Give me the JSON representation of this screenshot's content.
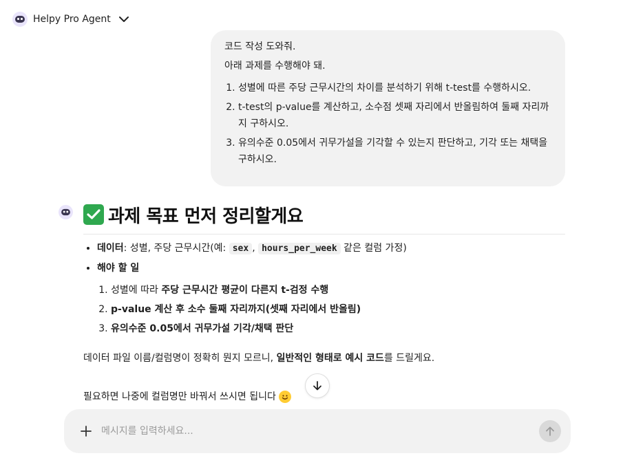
{
  "header": {
    "app_name": "Helpy Pro Agent"
  },
  "user_message": {
    "line1": "코드 작성 도와줘.",
    "line2": "아래 과제를 수행해야 돼.",
    "tasks": [
      "성별에 따른 주당 근무시간의 차이를 분석하기 위해 t-test를 수행하시오.",
      "t-test의 p-value를 계산하고, 소수점 셋째 자리에서 반올림하여 둘째 자리까지 구하시오.",
      "유의수준 0.05에서 귀무가설을 기각할 수 있는지 판단하고, 기각 또는 채택을 구하시오."
    ]
  },
  "answer": {
    "heading": "과제 목표 먼저 정리할게요",
    "bullet1_label": "데이터",
    "bullet1_text": ": 성별, 주당 근무시간(예: ",
    "code_sex": "sex",
    "comma": ",",
    "code_hours": "hours_per_week",
    "bullet1_tail": " 같은 컬럼 가정)",
    "bullet2_label": "해야 할 일",
    "step1_prefix": "성별에 따라 ",
    "step1_bold": "주당 근무시간 평균이 다른지 t-검정 수행",
    "step2_bold": "p-value 계산 후 소수 둘째 자리까지(셋째 자리에서 반올림)",
    "step3_bold": "유의수준 0.05에서 귀무가설 기각/채택 판단",
    "para1_prefix": "데이터 파일 이름/컬럼명이 정확히 뭔지 모르니, ",
    "para1_bold": "일반적인 형태로 예시 코드",
    "para1_suffix": "를 드릴게요.",
    "para2": "필요하면 나중에 컬럼명만 바꿔서 쓰시면 됩니다"
  },
  "composer": {
    "placeholder": "메시지를 입력하세요..."
  },
  "colors": {
    "accent_check": "#2fa84f",
    "bubble": "#f2f2f2",
    "avatar_bg": "#e9e4fb"
  },
  "icons": [
    "robot-avatar-icon",
    "chevron-down-icon",
    "check-mark-icon",
    "arrow-down-icon",
    "plus-icon",
    "arrow-up-icon",
    "smile-emoji-icon"
  ]
}
